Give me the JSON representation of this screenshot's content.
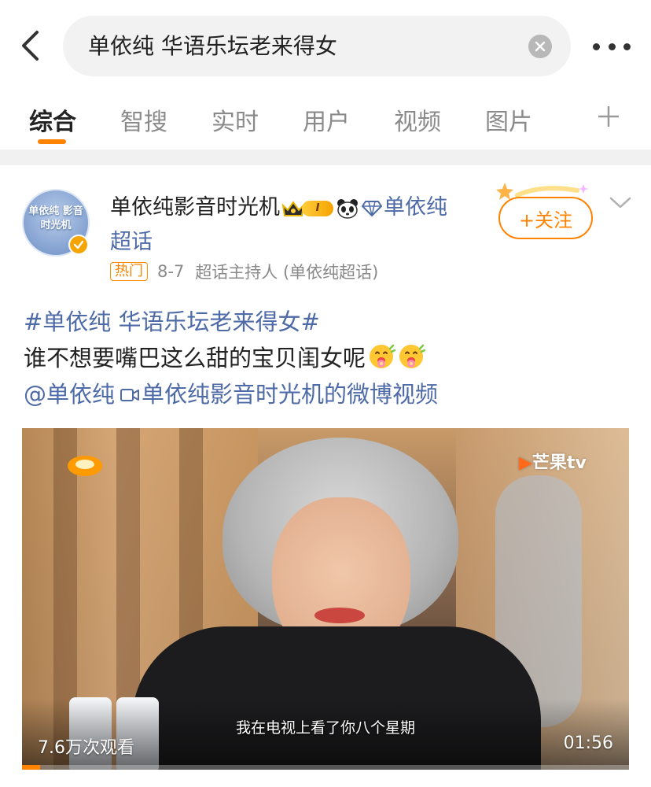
{
  "search": {
    "query": "单依纯 华语乐坛老来得女"
  },
  "tabs": [
    {
      "label": "综合",
      "active": true
    },
    {
      "label": "智搜",
      "active": false
    },
    {
      "label": "实时",
      "active": false
    },
    {
      "label": "用户",
      "active": false
    },
    {
      "label": "视频",
      "active": false
    },
    {
      "label": "图片",
      "active": false
    }
  ],
  "post": {
    "author": {
      "name": "单依纯影音时光机",
      "name_tail": "单依纯超话",
      "avatar_text": "单依纯 影音时光机",
      "level": "I"
    },
    "meta": {
      "hot_tag": "热门",
      "date": "8-7",
      "source": "超话主持人 (单依纯超话)"
    },
    "follow_label": "+关注",
    "text": {
      "topic": "#单依纯 华语乐坛老来得女#",
      "body": "谁不想要嘴巴这么甜的宝贝闺女呢",
      "mention": "@单依纯",
      "video_link": "单依纯影音时光机的微博视频"
    },
    "video": {
      "channel_logo": "芒果tv",
      "subtitle": "我在电视上看了你八个星期",
      "views": "7.6万次观看",
      "duration": "01:56",
      "progress": 0.03
    }
  },
  "colors": {
    "accent": "#ff8200",
    "link": "#4e6ba8",
    "divider": "#f1f1f1"
  },
  "icons": [
    "back-chevron-icon",
    "clear-icon",
    "more-icon",
    "plus-icon",
    "crown-icon",
    "panda-icon",
    "diamond-icon",
    "verified-icon",
    "chevron-down-icon",
    "video-camera-icon",
    "emoji-hug-icon"
  ]
}
